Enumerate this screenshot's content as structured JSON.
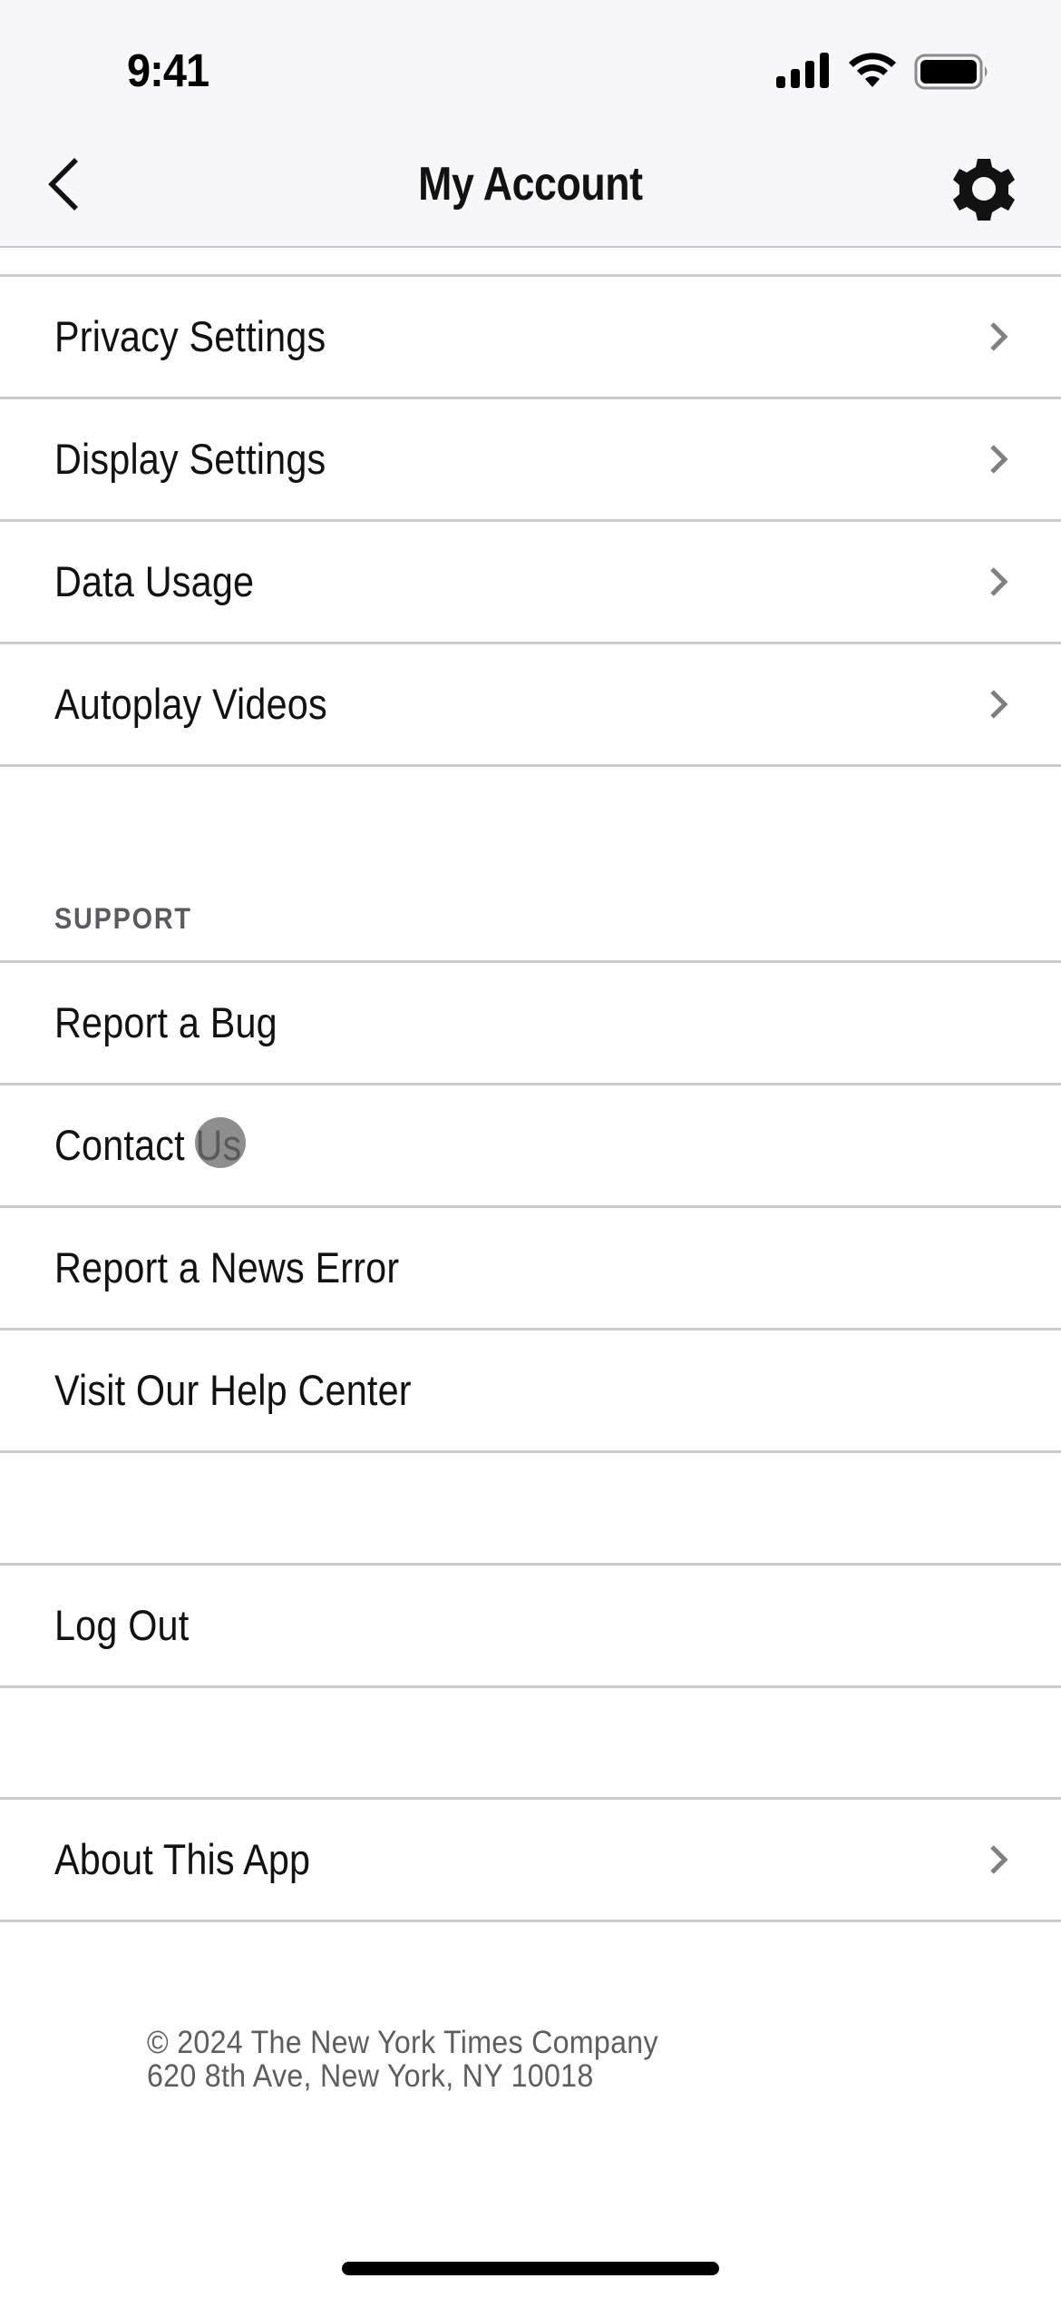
{
  "status_bar": {
    "time": "9:41",
    "icons": [
      "signal-icon",
      "wifi-icon",
      "battery-icon"
    ]
  },
  "nav": {
    "title": "My Account",
    "back_icon": "chevron-left-icon",
    "settings_icon": "gear-icon"
  },
  "settings_group": {
    "items": [
      {
        "label": "Privacy Settings",
        "has_chevron": true
      },
      {
        "label": "Display Settings",
        "has_chevron": true
      },
      {
        "label": "Data Usage",
        "has_chevron": true
      },
      {
        "label": "Autoplay Videos",
        "has_chevron": true
      }
    ]
  },
  "support_group": {
    "header": "SUPPORT",
    "items": [
      {
        "label": "Report a Bug",
        "has_chevron": false
      },
      {
        "label": "Contact Us",
        "has_chevron": false
      },
      {
        "label": "Report a News Error",
        "has_chevron": false
      },
      {
        "label": "Visit Our Help Center",
        "has_chevron": false
      }
    ]
  },
  "account_group": {
    "items": [
      {
        "label": "Log Out",
        "has_chevron": false
      }
    ]
  },
  "about_group": {
    "items": [
      {
        "label": "About This App",
        "has_chevron": true
      }
    ]
  },
  "footer": {
    "copyright": "© 2024 The New York Times Company",
    "address": "620 8th Ave, New York, NY 10018"
  },
  "colors": {
    "header_bg": "#f7f6f9",
    "divider": "#cacaca",
    "text": "#121212",
    "secondary_text": "#5e5e5e",
    "chevron": "#808080"
  }
}
